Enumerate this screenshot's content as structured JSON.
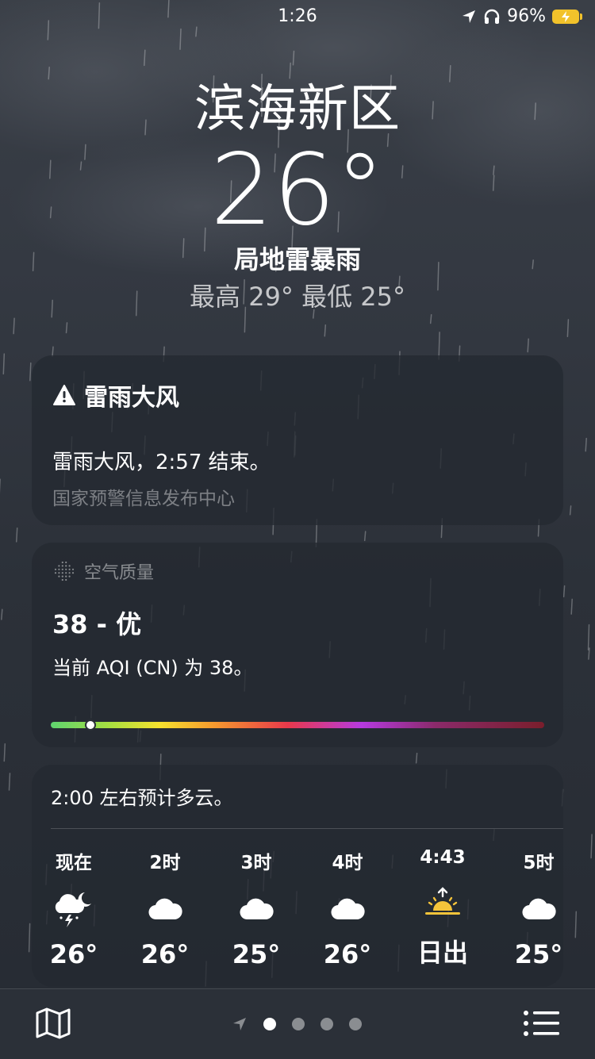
{
  "status_bar": {
    "time": "1:26",
    "battery": "96%"
  },
  "location": {
    "city": "滨海新区",
    "temperature": "26°",
    "condition": "局地雷暴雨",
    "high_low": "最高 29°  最低 25°"
  },
  "alert": {
    "title": "雷雨大风",
    "message": "雷雨大风，2:57 结束。",
    "source": "国家预警信息发布中心"
  },
  "air_quality": {
    "header": "空气质量",
    "value": "38 - 优",
    "description": "当前 AQI (CN) 为 38。",
    "aqi": 38,
    "indicator_fraction": 0.08
  },
  "hourly": {
    "summary": "2:00 左右预计多云。",
    "items": [
      {
        "label": "现在",
        "icon": "thunderstorm-moon-icon",
        "temp": "26°"
      },
      {
        "label": "2时",
        "icon": "cloud-icon",
        "temp": "26°"
      },
      {
        "label": "3时",
        "icon": "cloud-icon",
        "temp": "25°"
      },
      {
        "label": "4时",
        "icon": "cloud-icon",
        "temp": "26°"
      },
      {
        "label": "4:43",
        "icon": "sunrise-icon",
        "temp": "日出"
      },
      {
        "label": "5时",
        "icon": "cloud-icon",
        "temp": "25°"
      }
    ]
  },
  "bottom_bar": {
    "map_icon": "map-icon",
    "list_icon": "list-icon",
    "pages": 4,
    "active_page": 0
  },
  "colors": {
    "sunrise": "#f5c43a",
    "battery": "#f2c22b"
  }
}
